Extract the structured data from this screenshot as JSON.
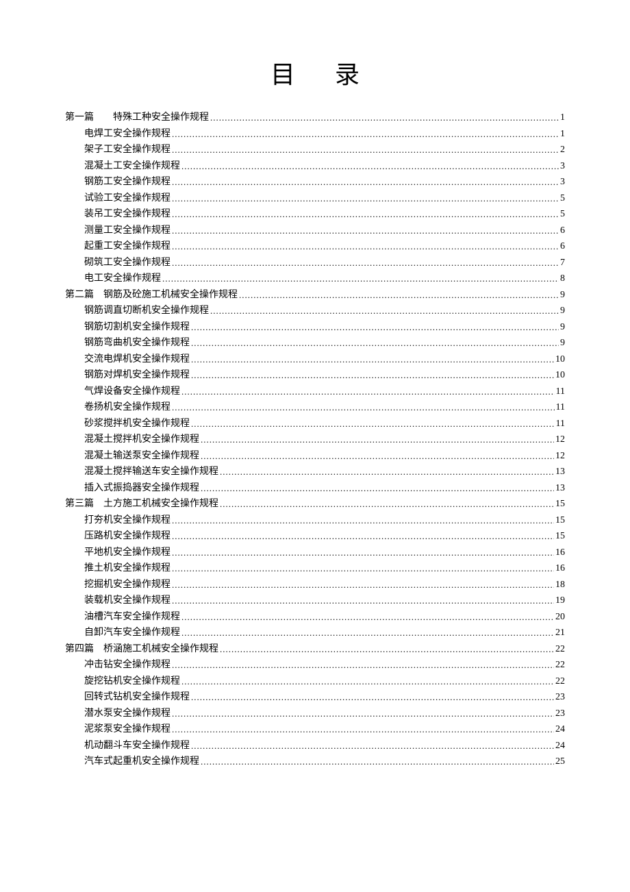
{
  "title": "目录",
  "toc": [
    {
      "level": 1,
      "label": "第一篇　　特殊工种安全操作规程",
      "page": "1"
    },
    {
      "level": 2,
      "label": "电焊工安全操作规程",
      "page": "1"
    },
    {
      "level": 2,
      "label": "架子工安全操作规程",
      "page": "2"
    },
    {
      "level": 2,
      "label": "混凝土工安全操作规程",
      "page": "3"
    },
    {
      "level": 2,
      "label": "钢筋工安全操作规程",
      "page": "3"
    },
    {
      "level": 2,
      "label": "试验工安全操作规程",
      "page": "5"
    },
    {
      "level": 2,
      "label": "装吊工安全操作规程",
      "page": "5"
    },
    {
      "level": 2,
      "label": "测量工安全操作规程",
      "page": "6"
    },
    {
      "level": 2,
      "label": "起重工安全操作规程",
      "page": "6"
    },
    {
      "level": 2,
      "label": "砌筑工安全操作规程",
      "page": "7"
    },
    {
      "level": 2,
      "label": "电工安全操作规程",
      "page": "8"
    },
    {
      "level": 1,
      "label": "第二篇　钢筋及砼施工机械安全操作规程",
      "page": "9"
    },
    {
      "level": 2,
      "label": "钢筋调直切断机安全操作规程",
      "page": "9"
    },
    {
      "level": 2,
      "label": "钢筋切割机安全操作规程",
      "page": "9"
    },
    {
      "level": 2,
      "label": "钢筋弯曲机安全操作规程",
      "page": "9"
    },
    {
      "level": 2,
      "label": "交流电焊机安全操作规程",
      "page": "10"
    },
    {
      "level": 2,
      "label": "钢筋对焊机安全操作规程",
      "page": "10"
    },
    {
      "level": 2,
      "label": "气焊设备安全操作规程",
      "page": "11"
    },
    {
      "level": 2,
      "label": "卷扬机安全操作规程",
      "page": "11"
    },
    {
      "level": 2,
      "label": "砂浆搅拌机安全操作规程",
      "page": "11"
    },
    {
      "level": 2,
      "label": "混凝土搅拌机安全操作规程",
      "page": "12"
    },
    {
      "level": 2,
      "label": "混凝土输送泵安全操作规程",
      "page": "12"
    },
    {
      "level": 2,
      "label": "混凝土搅拌输送车安全操作规程",
      "page": "13"
    },
    {
      "level": 2,
      "label": "插入式振捣器安全操作规程",
      "page": "13"
    },
    {
      "level": 1,
      "label": "第三篇　土方施工机械安全操作规程",
      "page": "15"
    },
    {
      "level": 2,
      "label": "打夯机安全操作规程",
      "page": "15"
    },
    {
      "level": 2,
      "label": "压路机安全操作规程",
      "page": "15"
    },
    {
      "level": 2,
      "label": "平地机安全操作规程",
      "page": "16"
    },
    {
      "level": 2,
      "label": "推土机安全操作规程",
      "page": "16"
    },
    {
      "level": 2,
      "label": "挖掘机安全操作规程",
      "page": "18"
    },
    {
      "level": 2,
      "label": "装载机安全操作规程",
      "page": "19"
    },
    {
      "level": 2,
      "label": "油槽汽车安全操作规程",
      "page": "20"
    },
    {
      "level": 2,
      "label": "自卸汽车安全操作规程",
      "page": "21"
    },
    {
      "level": 1,
      "label": "第四篇　桥涵施工机械安全操作规程",
      "page": "22"
    },
    {
      "level": 2,
      "label": "冲击钻安全操作规程",
      "page": "22"
    },
    {
      "level": 2,
      "label": "旋挖钻机安全操作规程",
      "page": "22"
    },
    {
      "level": 2,
      "label": "回转式钻机安全操作规程",
      "page": "23"
    },
    {
      "level": 2,
      "label": "潜水泵安全操作规程",
      "page": "23"
    },
    {
      "level": 2,
      "label": "泥浆泵安全操作规程",
      "page": "24"
    },
    {
      "level": 2,
      "label": "机动翻斗车安全操作规程",
      "page": "24"
    },
    {
      "level": 2,
      "label": "汽车式起重机安全操作规程",
      "page": "25"
    }
  ]
}
